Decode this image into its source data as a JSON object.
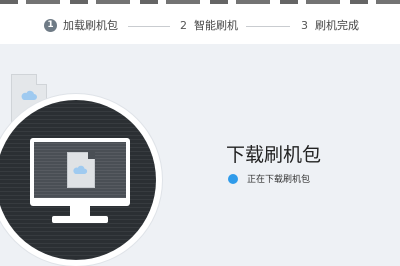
{
  "steps": [
    {
      "number": "1",
      "label": "加载刷机包",
      "state": "active"
    },
    {
      "number": "2",
      "label": "智能刷机",
      "state": "pending"
    },
    {
      "number": "3",
      "label": "刷机完成",
      "state": "pending"
    }
  ],
  "main": {
    "title": "下载刷机包",
    "status_text": "正在下载刷机包"
  },
  "icons": {
    "background_document": "cloud-document-icon",
    "monitor": "monitor-icon",
    "screen_document": "cloud-document-icon",
    "status": "status-dot-icon"
  },
  "colors": {
    "accent": "#2f9bea",
    "active_step_circle": "#6f7b86",
    "panel_background": "#eef1f5",
    "circle_dark": "#2b2f33"
  }
}
